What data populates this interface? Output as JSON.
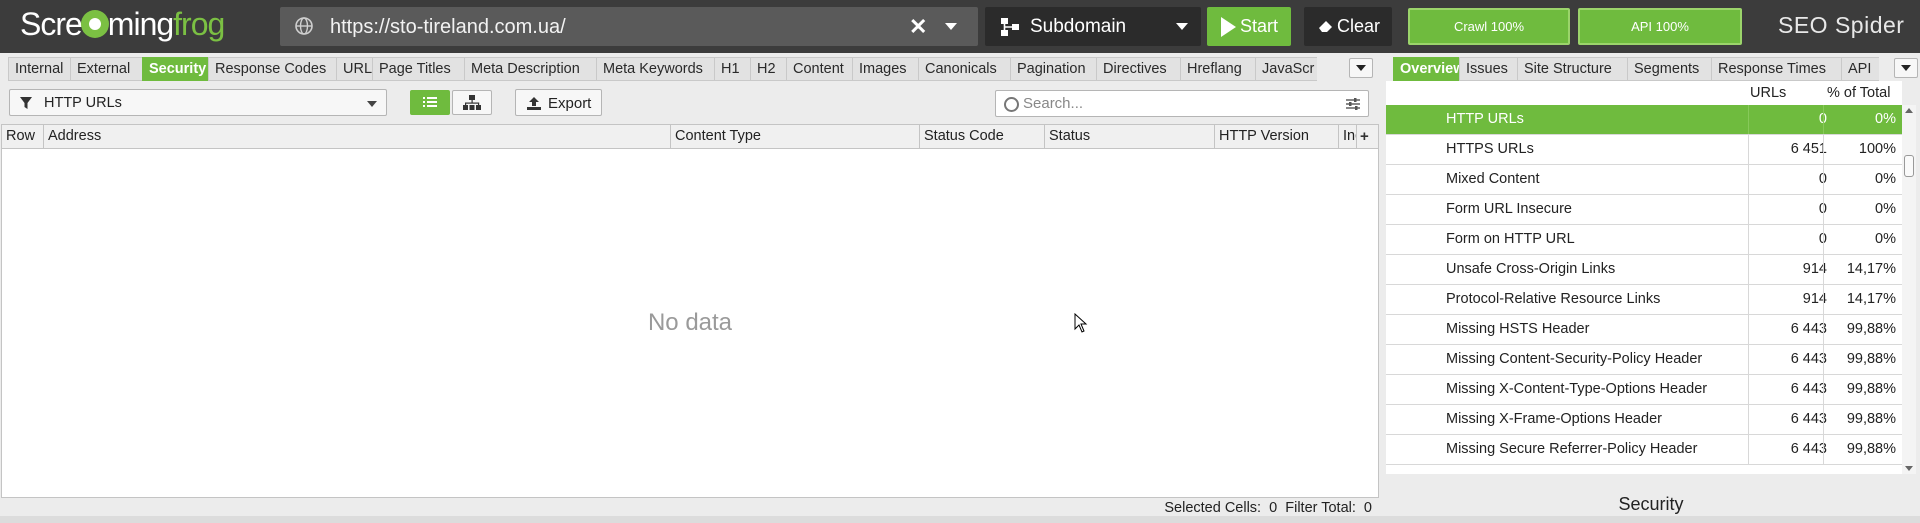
{
  "app": {
    "logo_text_a": "Scre",
    "logo_text_b": "ming",
    "logo_text_c": "frog",
    "brand": "SEO Spider",
    "accent_color": "#6fbb3e"
  },
  "toolbar": {
    "url_value": "https://sto-tireland.com.ua/",
    "mode_label": "Subdomain",
    "start_label": "Start",
    "clear_label": "Clear",
    "crawl_progress_label": "Crawl 100%",
    "api_progress_label": "API 100%",
    "crawl_progress": 100,
    "api_progress": 100
  },
  "left_tabs": [
    {
      "label": "Internal",
      "active": false
    },
    {
      "label": "External",
      "active": false
    },
    {
      "label": "Security",
      "active": true
    },
    {
      "label": "Response Codes",
      "active": false
    },
    {
      "label": "URL",
      "active": false
    },
    {
      "label": "Page Titles",
      "active": false
    },
    {
      "label": "Meta Description",
      "active": false
    },
    {
      "label": "Meta Keywords",
      "active": false
    },
    {
      "label": "H1",
      "active": false
    },
    {
      "label": "H2",
      "active": false
    },
    {
      "label": "Content",
      "active": false
    },
    {
      "label": "Images",
      "active": false
    },
    {
      "label": "Canonicals",
      "active": false
    },
    {
      "label": "Pagination",
      "active": false
    },
    {
      "label": "Directives",
      "active": false
    },
    {
      "label": "Hreflang",
      "active": false
    },
    {
      "label": "JavaScr",
      "active": false
    }
  ],
  "right_tabs": [
    {
      "label": "Overview",
      "active": true
    },
    {
      "label": "Issues",
      "active": false
    },
    {
      "label": "Site Structure",
      "active": false
    },
    {
      "label": "Segments",
      "active": false
    },
    {
      "label": "Response Times",
      "active": false
    },
    {
      "label": "API",
      "active": false
    }
  ],
  "filter": {
    "selected": "HTTP URLs",
    "export_label": "Export",
    "search_placeholder": "Search..."
  },
  "table": {
    "columns": [
      "Row",
      "Address",
      "Content Type",
      "Status Code",
      "Status",
      "HTTP Version",
      "Ind"
    ],
    "empty_text": "No data",
    "add_column_symbol": "+",
    "status": {
      "selected_cells_label": "Selected Cells:",
      "selected_cells_value": "0",
      "filter_total_label": "Filter Total:",
      "filter_total_value": "0"
    }
  },
  "overview": {
    "col_urls": "URLs",
    "col_pct": "% of Total",
    "rows": [
      {
        "name": "HTTP URLs",
        "count": "0",
        "pct": "0%",
        "selected": true
      },
      {
        "name": "HTTPS URLs",
        "count": "6 451",
        "pct": "100%",
        "selected": false
      },
      {
        "name": "Mixed Content",
        "count": "0",
        "pct": "0%",
        "selected": false
      },
      {
        "name": "Form URL Insecure",
        "count": "0",
        "pct": "0%",
        "selected": false
      },
      {
        "name": "Form on HTTP URL",
        "count": "0",
        "pct": "0%",
        "selected": false
      },
      {
        "name": "Unsafe Cross-Origin Links",
        "count": "914",
        "pct": "14,17%",
        "selected": false
      },
      {
        "name": "Protocol-Relative Resource Links",
        "count": "914",
        "pct": "14,17%",
        "selected": false
      },
      {
        "name": "Missing HSTS Header",
        "count": "6 443",
        "pct": "99,88%",
        "selected": false
      },
      {
        "name": "Missing Content-Security-Policy Header",
        "count": "6 443",
        "pct": "99,88%",
        "selected": false
      },
      {
        "name": "Missing X-Content-Type-Options Header",
        "count": "6 443",
        "pct": "99,88%",
        "selected": false
      },
      {
        "name": "Missing X-Frame-Options Header",
        "count": "6 443",
        "pct": "99,88%",
        "selected": false
      },
      {
        "name": "Missing Secure Referrer-Policy Header",
        "count": "6 443",
        "pct": "99,88%",
        "selected": false
      }
    ],
    "footer_title": "Security"
  }
}
